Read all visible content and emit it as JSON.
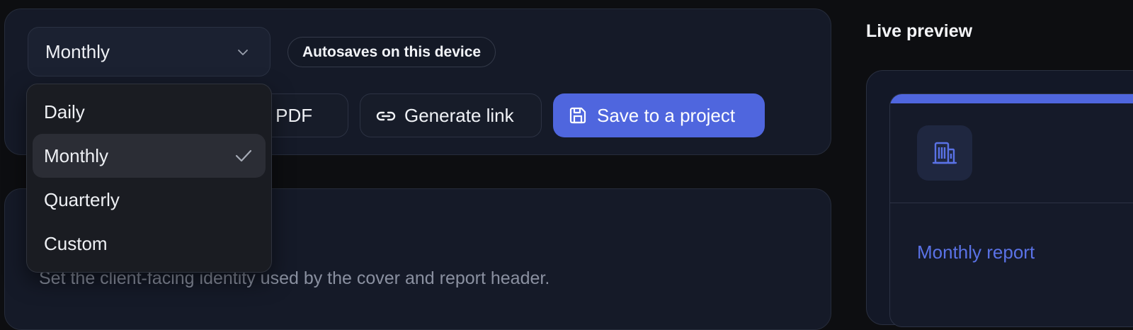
{
  "period_select": {
    "value": "Monthly",
    "options": [
      "Daily",
      "Monthly",
      "Quarterly",
      "Custom"
    ],
    "selected_index": 1
  },
  "autosave_badge": "Autosaves on this device",
  "actions": {
    "download_pdf_partial": "ad PDF",
    "generate_link": "Generate link",
    "save_to_project": "Save to a project"
  },
  "section": {
    "subtitle": "Set the client-facing identity used by the cover and report header."
  },
  "preview": {
    "title": "Live preview",
    "report_title": "Monthly report"
  },
  "colors": {
    "accent": "#4f66de",
    "background": "#0d0e11",
    "panel": "#151a28"
  },
  "icons": {
    "select_chevron": "chevron-down-icon",
    "generate_link": "link-icon",
    "save_project": "save-icon",
    "selected_option": "check-icon",
    "preview_logo": "building-icon"
  }
}
